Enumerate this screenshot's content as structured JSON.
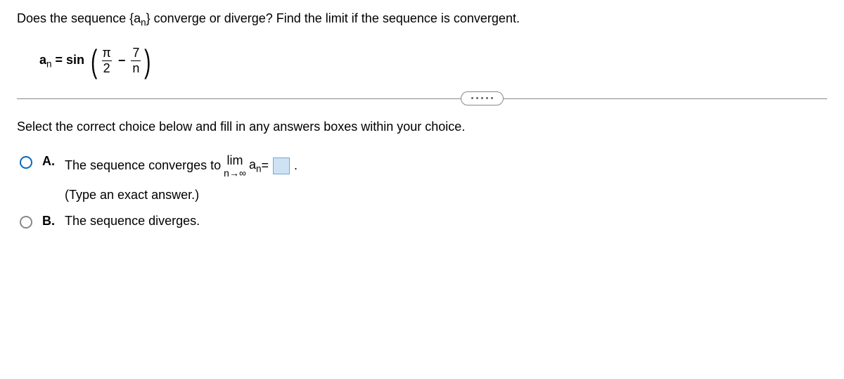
{
  "question": {
    "prefix": "Does the sequence {a",
    "sub1": "n",
    "suffix": "} converge or diverge? Find the limit if the sequence is convergent."
  },
  "formula": {
    "a": "a",
    "n": "n",
    "eq": " = ",
    "sin": "sin",
    "pi": "π",
    "two": "2",
    "minus": "−",
    "seven": "7",
    "nden": "n"
  },
  "instruction": "Select the correct choice below and fill in any answers boxes within your choice.",
  "choiceA": {
    "letter": "A.",
    "text1": "The sequence converges to ",
    "lim": "lim",
    "limsub": "n→∞",
    "an_a": "a",
    "an_n": "n",
    "eq": " = ",
    "period": ".",
    "hint": "(Type an exact answer.)"
  },
  "choiceB": {
    "letter": "B.",
    "text": "The sequence diverges."
  }
}
